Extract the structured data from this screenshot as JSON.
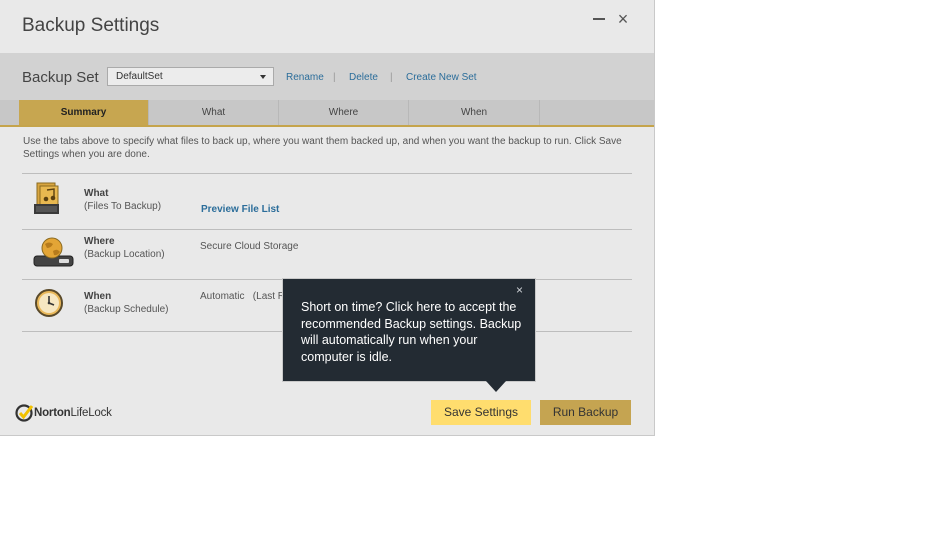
{
  "window": {
    "title": "Backup Settings"
  },
  "setbar": {
    "label": "Backup Set",
    "selected_set": "DefaultSet",
    "rename": "Rename",
    "delete": "Delete",
    "create": "Create New Set",
    "separator": "|"
  },
  "tabs": [
    {
      "label": "Summary",
      "active": true
    },
    {
      "label": "What"
    },
    {
      "label": "Where"
    },
    {
      "label": "When"
    }
  ],
  "description": "Use the tabs above to specify what files to back up, where you want them backed up, and when you want the backup to run. Click Save Settings when you are done.",
  "rows": {
    "what": {
      "title": "What",
      "sub": "(Files To Backup)",
      "link": "Preview File List"
    },
    "where": {
      "title": "Where",
      "sub": "(Backup Location)",
      "value": "Secure Cloud Storage"
    },
    "when": {
      "title": "When",
      "sub": "(Backup Schedule)",
      "value": "Automatic   (Last R"
    }
  },
  "tooltip": {
    "text": "Short on time? Click here to accept the recommended Backup settings. Backup will automatically run when your computer is idle.",
    "close": "×"
  },
  "logo": {
    "brand_bold": "Norton",
    "brand_rest": "LifeLock"
  },
  "buttons": {
    "save": "Save Settings",
    "run": "Run Backup"
  },
  "colors": {
    "accent_gold": "#c7a650",
    "save_yellow": "#ffdd6e",
    "tooltip_bg": "#232b33",
    "link_blue": "#2b6d9a"
  }
}
